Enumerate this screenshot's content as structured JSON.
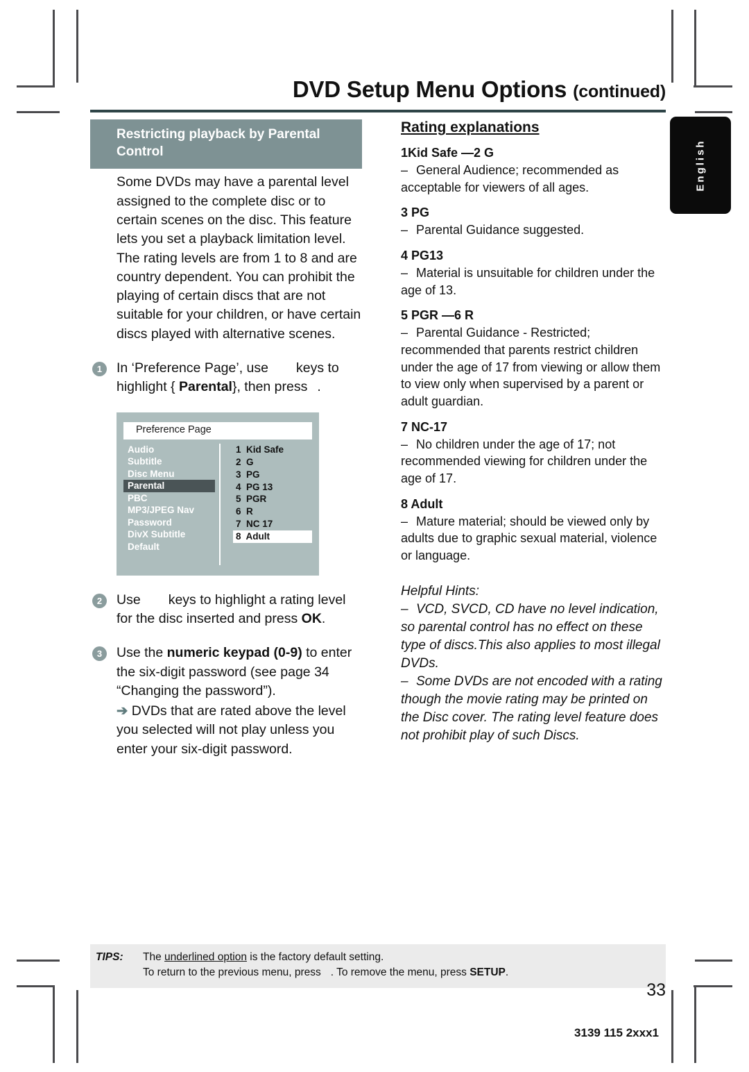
{
  "header": {
    "title": "DVD Setup Menu Options",
    "continued": "(continued)"
  },
  "language_tab": {
    "label": "English"
  },
  "left_column": {
    "section_heading": "Restricting playback by Parental Control",
    "intro_paragraph": "Some DVDs may have a parental level assigned to the complete disc or to certain scenes on the disc. This feature lets you set a playback limitation level. The rating levels are from 1 to 8 and are country dependent. You can prohibit the playing of certain discs that are not suitable for your children, or have certain discs played with alternative scenes.",
    "steps": [
      {
        "number": "1",
        "line1_a": "In ‘Preference Page’, use",
        "line1_b": "keys to",
        "line2_a": "highlight {",
        "line2_bold": "Parental",
        "line2_b": "}, then press",
        "line2_c": "."
      },
      {
        "number": "2",
        "line1_a": "Use",
        "line1_b": "keys to highlight a rating level",
        "line2_a": "for the disc inserted and press",
        "line2_bold": "OK",
        "line2_c": "."
      },
      {
        "number": "3",
        "line1_a": "Use the",
        "line1_bold": "numeric keypad (0-9)",
        "line1_b": "to enter",
        "line2": "the six-digit password (see page 34",
        "line3": "“Changing the password”).",
        "arrow_text": "DVDs that are rated above the level you selected will not play unless you enter your six-digit password.",
        "arrow_glyph": "➔"
      }
    ]
  },
  "osd_screenshot": {
    "title": "Preference Page",
    "menu_items": [
      {
        "label": "Audio",
        "selected": false
      },
      {
        "label": "Subtitle",
        "selected": false
      },
      {
        "label": "Disc Menu",
        "selected": false
      },
      {
        "label": "Parental",
        "selected": true
      },
      {
        "label": "PBC",
        "selected": false
      },
      {
        "label": "MP3/JPEG Nav",
        "selected": false
      },
      {
        "label": "Password",
        "selected": false
      },
      {
        "label": "DivX Subtitle",
        "selected": false
      },
      {
        "label": "Default",
        "selected": false
      }
    ],
    "options": [
      {
        "label": "1  Kid Safe",
        "selected": false
      },
      {
        "label": "2  G",
        "selected": false
      },
      {
        "label": "3  PG",
        "selected": false
      },
      {
        "label": "4  PG 13",
        "selected": false
      },
      {
        "label": "5  PGR",
        "selected": false
      },
      {
        "label": "6  R",
        "selected": false
      },
      {
        "label": "7  NC 17",
        "selected": false
      },
      {
        "label": "8  Adult",
        "selected": true
      }
    ],
    "colors": {
      "background": "#adbdbd",
      "highlight": "#4a5456",
      "selected_option": "#ffffff"
    }
  },
  "right_column": {
    "heading": "Rating explanations",
    "ratings": [
      {
        "label": "1Kid Safe —2 G",
        "description": "General Audience; recommended as acceptable for viewers of all ages."
      },
      {
        "label": "3 PG",
        "description": "Parental Guidance suggested."
      },
      {
        "label": "4 PG13",
        "description": "Material is unsuitable for children under the age of 13."
      },
      {
        "label": "5 PGR —6 R",
        "description": "Parental Guidance - Restricted; recommended that parents restrict children under the age of 17 from viewing or allow them to view only when supervised by a parent or adult guardian."
      },
      {
        "label": "7 NC-17",
        "description": "No children under the age of 17; not recommended viewing for children under the age of 17."
      },
      {
        "label": "8  Adult",
        "description": "Mature material; should be viewed only by adults due to graphic sexual material, violence or language."
      }
    ],
    "helpful_hints": {
      "title": "Helpful Hints:",
      "items": [
        "VCD, SVCD, CD have no level indication, so parental control has no effect on these type of discs.This also applies to most illegal DVDs.",
        "Some DVDs are not encoded with a rating though the movie rating may be printed on the Disc cover. The rating level feature does not prohibit play of such Discs."
      ]
    }
  },
  "tips": {
    "label": "TIPS:",
    "line1_a": "The",
    "line1_underlined": "underlined option",
    "line1_b": "is the factory default setting.",
    "line2_a": "To return to the previous menu, press",
    "line2_b": ". To remove the menu, press",
    "line2_bold": "SETUP",
    "line2_c": "."
  },
  "footer": {
    "page_number": "33",
    "document_code": "3139 115 2xxx1"
  },
  "theme": {
    "banner_color": "#7e9294",
    "rule_color": "#2e4447",
    "tips_background": "#ebebeb",
    "tab_background": "#0b0b0b"
  }
}
